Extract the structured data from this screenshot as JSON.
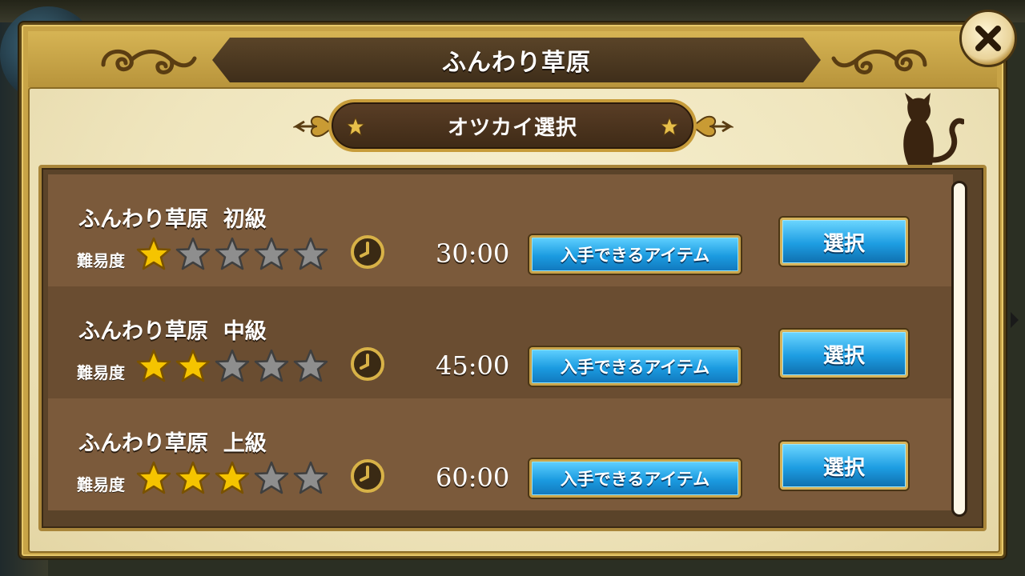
{
  "header": {
    "title": "ふんわり草原"
  },
  "subheader": {
    "title": "オツカイ選択"
  },
  "quests": [
    {
      "title": "ふんわり草原  初級",
      "difficulty_label": "難易度",
      "difficulty": 1,
      "max_difficulty": 5,
      "time": "30:00",
      "items_label": "入手できるアイテム",
      "select_label": "選択"
    },
    {
      "title": "ふんわり草原  中級",
      "difficulty_label": "難易度",
      "difficulty": 2,
      "max_difficulty": 5,
      "time": "45:00",
      "items_label": "入手できるアイテム",
      "select_label": "選択"
    },
    {
      "title": "ふんわり草原  上級",
      "difficulty_label": "難易度",
      "difficulty": 3,
      "max_difficulty": 5,
      "time": "60:00",
      "items_label": "入手できるアイテム",
      "select_label": "選択"
    }
  ],
  "icons": {
    "close": "close-icon",
    "clock": "clock-icon",
    "star_filled": "star-filled-icon",
    "star_empty": "star-empty-icon",
    "cat": "cat-icon"
  },
  "colors": {
    "star_filled": "#f5c400",
    "star_empty": "#8e8e8e",
    "button_blue": "#1b9be0",
    "frame_gold": "#c8a447"
  }
}
